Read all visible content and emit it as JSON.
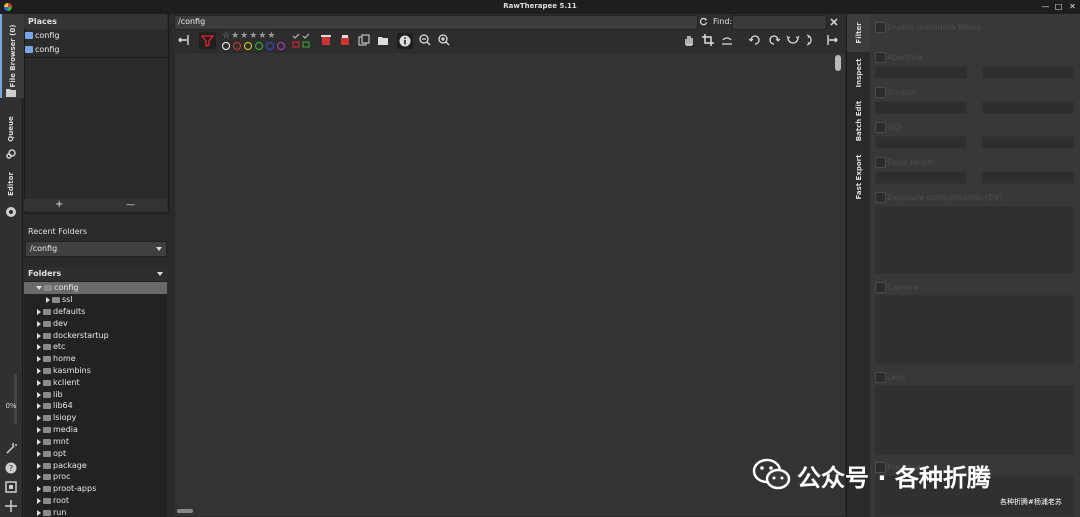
{
  "window": {
    "title": "RawTherapee 5.11",
    "minimize": "—",
    "maximize": "□",
    "close": "✕"
  },
  "left_tabs": [
    {
      "label": "File Browser (0)",
      "icon": "folder-icon"
    },
    {
      "label": "Queue",
      "icon": "gears-icon"
    },
    {
      "label": "Editor",
      "icon": "aperture-icon"
    }
  ],
  "left_tools": {
    "progress": "0%"
  },
  "places": {
    "header": "Places",
    "items": [
      "config",
      "config"
    ],
    "add_label": "+",
    "remove_label": "—"
  },
  "recent_folders": {
    "header": "Recent Folders",
    "value": "/config"
  },
  "folders": {
    "header": "Folders",
    "items": [
      {
        "name": "config",
        "level": 1,
        "expanded": true,
        "selected": true
      },
      {
        "name": "ssl",
        "level": 2
      },
      {
        "name": "defaults",
        "level": 1
      },
      {
        "name": "dev",
        "level": 1
      },
      {
        "name": "dockerstartup",
        "level": 1
      },
      {
        "name": "etc",
        "level": 1
      },
      {
        "name": "home",
        "level": 1
      },
      {
        "name": "kasmbins",
        "level": 1
      },
      {
        "name": "kclient",
        "level": 1
      },
      {
        "name": "lib",
        "level": 1
      },
      {
        "name": "lib64",
        "level": 1
      },
      {
        "name": "lsiopy",
        "level": 1
      },
      {
        "name": "media",
        "level": 1
      },
      {
        "name": "mnt",
        "level": 1
      },
      {
        "name": "opt",
        "level": 1
      },
      {
        "name": "package",
        "level": 1
      },
      {
        "name": "proc",
        "level": 1
      },
      {
        "name": "proot-apps",
        "level": 1
      },
      {
        "name": "root",
        "level": 1
      },
      {
        "name": "run",
        "level": 1
      }
    ]
  },
  "path_bar": {
    "path": "/config",
    "find_label": "Find:",
    "find_value": ""
  },
  "rating_colors": [
    "#ffffff",
    "#e03030",
    "#e0d020",
    "#30c030",
    "#3050e0",
    "#b040c0"
  ],
  "right_tabs": [
    "Filter",
    "Inspect",
    "Batch Edit",
    "Fast Export"
  ],
  "filter_panel": {
    "enable_metadata": "Enable metadata filters",
    "aperture": "Aperture",
    "shutter": "Shutter",
    "iso": "ISO",
    "focal_length": "Focal length",
    "exposure_comp": "Exposure compensation (EV)",
    "camera": "Camera",
    "lens": "Lens",
    "filetype": "File type"
  },
  "watermark": {
    "main": "公众号 · 各种折腾",
    "sub": "各种折腾#杨浦老苏"
  }
}
